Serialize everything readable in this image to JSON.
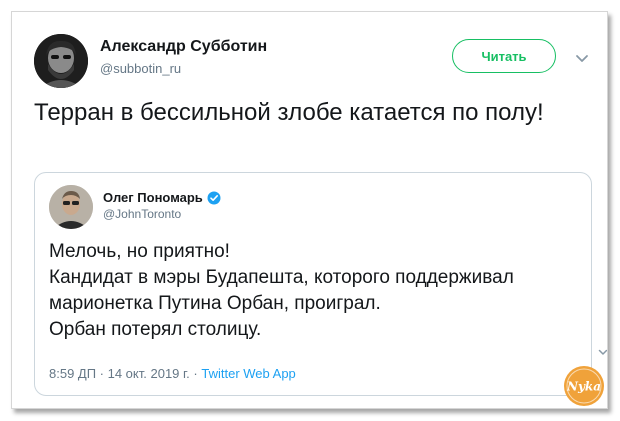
{
  "tweet": {
    "author_name": "Александр Субботин",
    "author_handle": "@subbotin_ru",
    "follow_label": "Читать",
    "text": "Терран в бессильной злобе катается по полу!"
  },
  "quoted_tweet": {
    "author_name": "Олег Пономарь",
    "author_handle": "@JohnToronto",
    "lines": [
      "Мелочь, но приятно!",
      "Кандидат в мэры Будапешта, которого поддерживал",
      "марионетка Путина Орбан, проиграл.",
      "Орбан потерял столицу."
    ],
    "timestamp": "8:59 ДП · 14 окт. 2019 г.",
    "separator": " · ",
    "source": "Twitter Web App"
  },
  "watermark": {
    "text": "Nyka"
  },
  "colors": {
    "follow_green": "#17bf63",
    "link_blue": "#1da1f2",
    "verified_blue": "#1da1f2",
    "text_primary": "#14171a",
    "text_secondary": "#657786",
    "watermark_orange": "#f0a23a"
  },
  "icons": {
    "dropdown": "chevron-down-icon",
    "verified": "verified-badge-icon"
  }
}
